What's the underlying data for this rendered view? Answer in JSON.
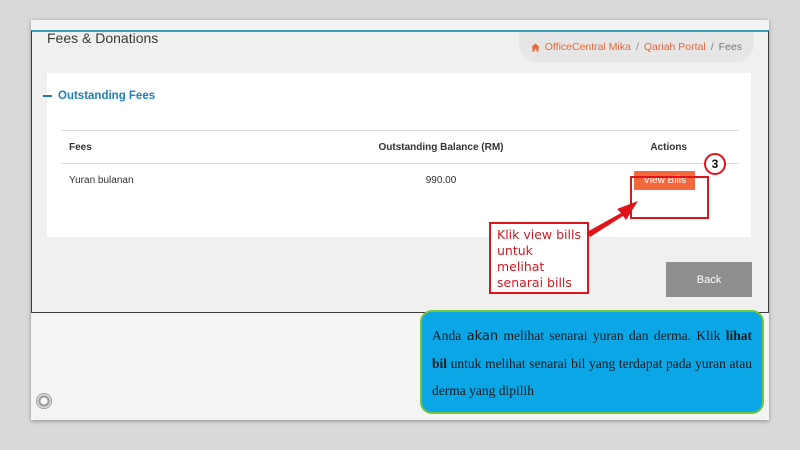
{
  "page": {
    "title": "Fees & Donations"
  },
  "breadcrumb": {
    "items": [
      "OfficeCentral Mika",
      "Qariah Portal"
    ],
    "separator": "/",
    "current": "Fees"
  },
  "section": {
    "title": "Outstanding Fees"
  },
  "table": {
    "columns": [
      "Fees",
      "Outstanding Balance (RM)",
      "Actions"
    ],
    "rows": [
      {
        "fee": "Yuran bulanan",
        "balance": "990.00",
        "action_label": "View Bills"
      }
    ]
  },
  "annotation": {
    "step": "3",
    "callout_lines": [
      "Klik view bills",
      "untuk melihat",
      "senarai bills"
    ]
  },
  "back_label": "Back",
  "note": {
    "part1": "Anda ",
    "part2": "akan",
    "part3": " melihat senarai yuran dan derma. Klik ",
    "part4": "lihat bil",
    "part5": " untuk melihat senarai bil yang terdapat pada yuran atau derma yang dipilih"
  },
  "colors": {
    "accent": "#e5683b",
    "section_blue": "#1e7fb8",
    "button_orange": "#f26a3c",
    "annotation_red": "#e1141c",
    "note_blue": "#0aa6e6",
    "note_border": "#76c43b",
    "back_gray": "#8e8e8e"
  },
  "icons": {
    "breadcrumb_home": "home-icon",
    "slide_audio": "speaker-icon"
  }
}
